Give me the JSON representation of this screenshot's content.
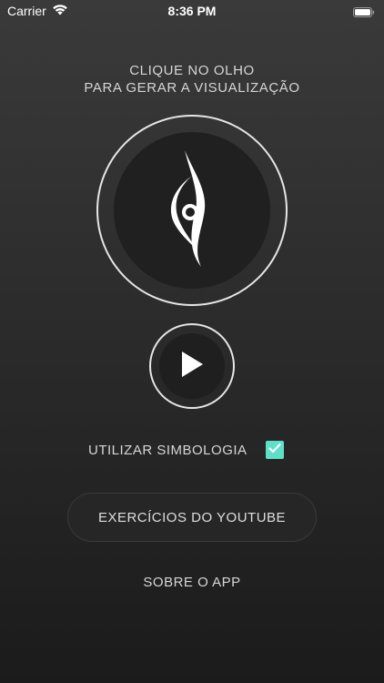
{
  "status_bar": {
    "carrier": "Carrier",
    "time": "8:36 PM"
  },
  "instruction": {
    "line1": "CLIQUE NO OLHO",
    "line2": "PARA GERAR A VISUALIZAÇÃO"
  },
  "symbology": {
    "label": "UTILIZAR SIMBOLOGIA",
    "checked": true
  },
  "youtube_button": {
    "label": "EXERCÍCIOS DO YOUTUBE"
  },
  "about_link": {
    "label": "SOBRE O APP"
  },
  "colors": {
    "accent_checkbox": "#5ee0c8",
    "text": "#d6d6d6",
    "ring": "#e6e6e6"
  },
  "icons": [
    "wifi-icon",
    "battery-icon",
    "eye-icon",
    "play-icon",
    "checkmark-icon"
  ]
}
